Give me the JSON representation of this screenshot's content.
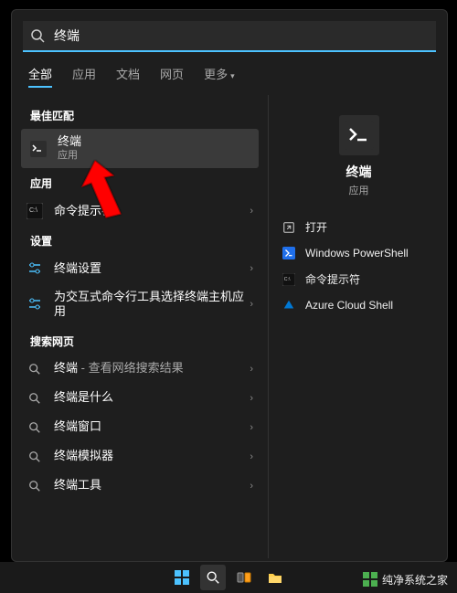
{
  "search": {
    "query": "终端"
  },
  "tabs": {
    "t0": "全部",
    "t1": "应用",
    "t2": "文档",
    "t3": "网页",
    "t4": "更多"
  },
  "sections": {
    "best": "最佳匹配",
    "apps": "应用",
    "settings": "设置",
    "websearch": "搜索网页"
  },
  "best": {
    "title": "终端",
    "sub": "应用"
  },
  "apps": {
    "a0": "命令提示符"
  },
  "settings": {
    "s0": "终端设置",
    "s1": "为交互式命令行工具选择终端主机应用"
  },
  "web": {
    "w0_a": "终端",
    "w0_b": " - 查看网络搜索结果",
    "w1": "终端是什么",
    "w2": "终端窗口",
    "w3": "终端模拟器",
    "w4": "终端工具"
  },
  "detail": {
    "title": "终端",
    "sub": "应用",
    "a0": "打开",
    "a1": "Windows PowerShell",
    "a2": "命令提示符",
    "a3": "Azure Cloud Shell"
  },
  "watermark": "纯净系统之家"
}
